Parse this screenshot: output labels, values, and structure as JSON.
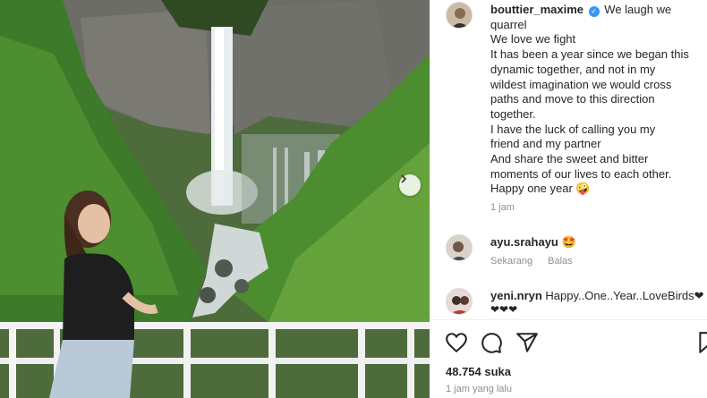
{
  "post": {
    "username": "bouttier_maxime",
    "caption_lines": [
      "We laugh we",
      "quarrel",
      "We love we fight",
      "It has been a year since we began this",
      "dynamic together, and not in my",
      "wildest imagination we would cross",
      "paths and move to this direction",
      "together.",
      "I have the luck of calling you my",
      "friend and my partner",
      "And share the sweet and bitter",
      "moments of our lives to each other.",
      "Happy one year 🤪"
    ],
    "caption_time": "1 jam",
    "likes": "48.754 suka",
    "posted": "1 jam yang lalu"
  },
  "comments": [
    {
      "username": "ayu.srahayu",
      "text": "🤩",
      "time": "Sekarang",
      "reply": "Balas"
    },
    {
      "username": "yeni.nryn",
      "text": "Happy..One..Year..LoveBirds❤",
      "text2": "❤❤❤"
    }
  ],
  "icons": {
    "verified": "verified-badge",
    "like": "heart-icon",
    "comment": "comment-icon",
    "share": "share-icon",
    "save": "bookmark-icon",
    "next": "chevron-right-icon"
  },
  "colors": {
    "verified": "#3897f0",
    "meta": "#8e8e8e",
    "text": "#262626"
  }
}
